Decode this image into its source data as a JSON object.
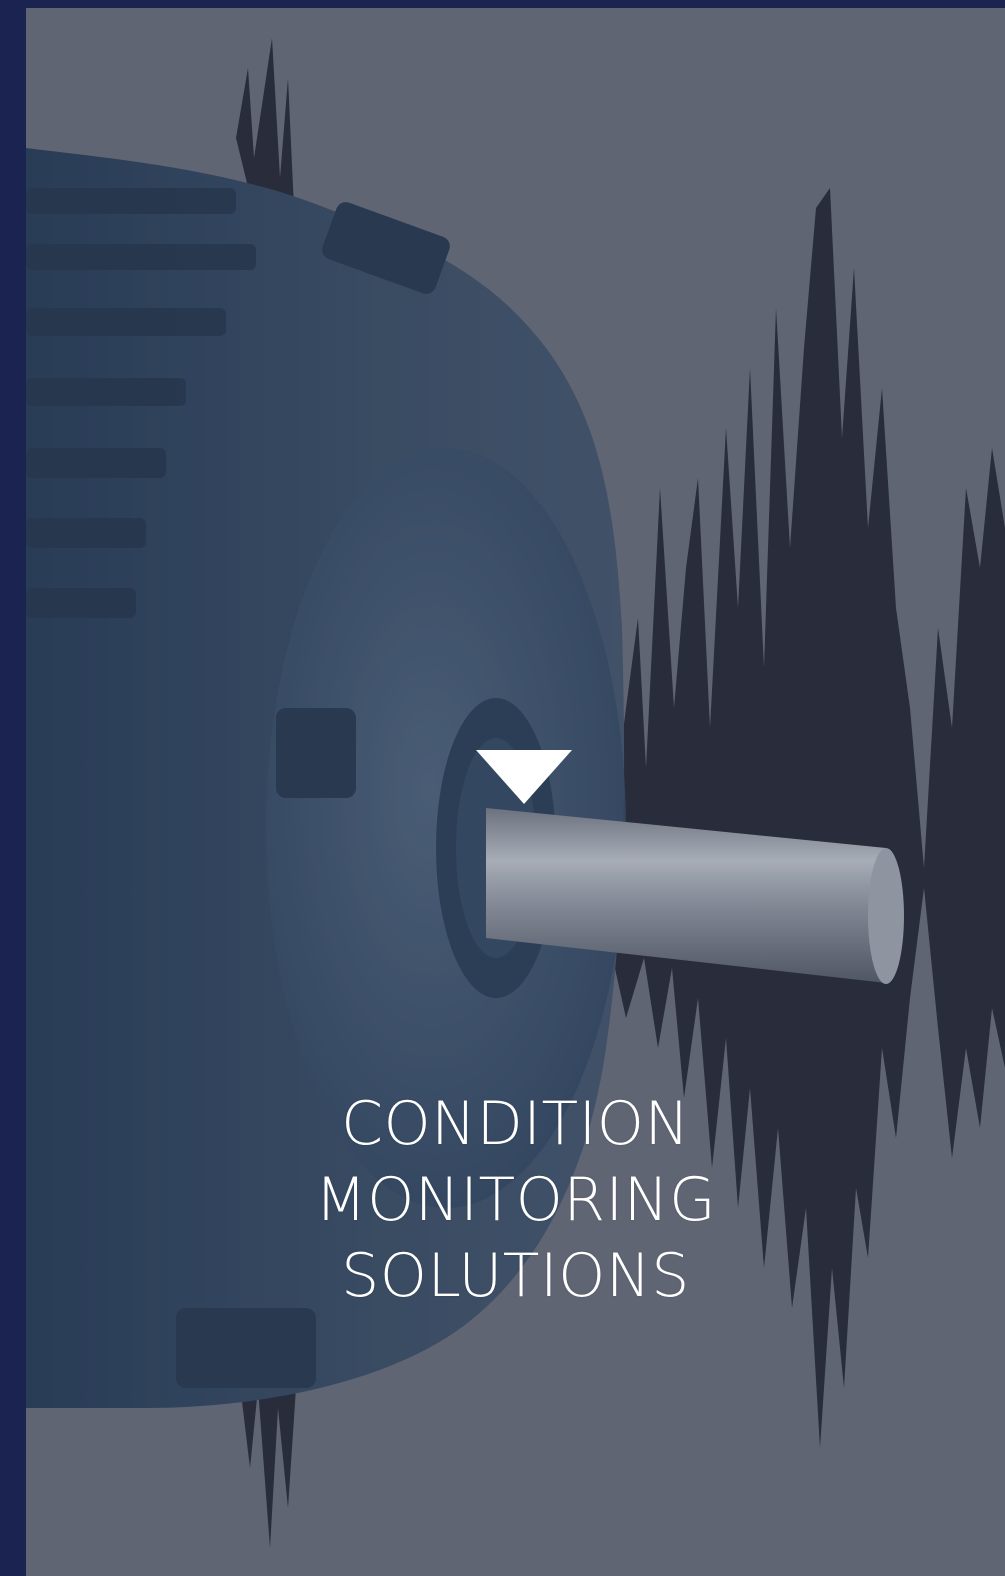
{
  "colors": {
    "frame": "#1b2450",
    "card_background": "#626775",
    "motor_body": "#30455f",
    "waveform": "#1a1f2b",
    "shaft": "#9aa1ab",
    "title_text": "#ffffff",
    "arrow": "#ffffff"
  },
  "hero": {
    "arrow_icon": "triangle-down",
    "title_lines": [
      "CONDITION",
      "MONITORING",
      "SOLUTIONS"
    ]
  }
}
